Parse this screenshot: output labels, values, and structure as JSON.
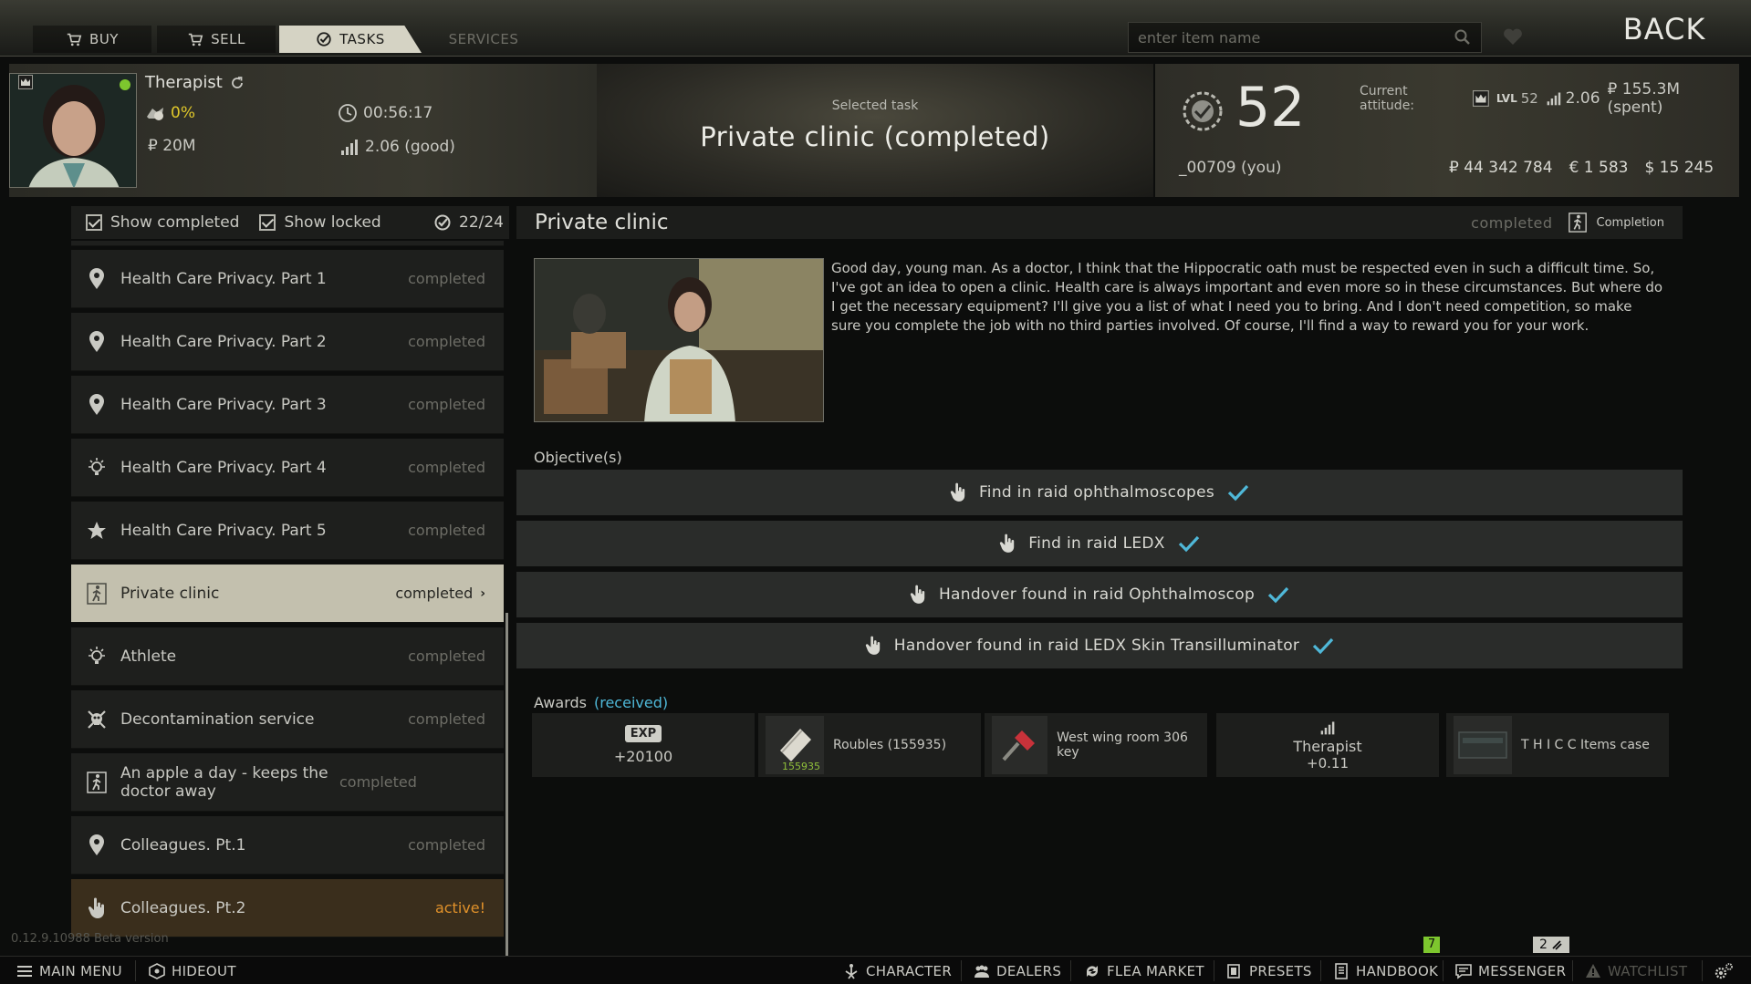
{
  "tabs": [
    {
      "label": "BUY",
      "icon": "cart-icon"
    },
    {
      "label": "SELL",
      "icon": "cart-icon"
    },
    {
      "label": "TASKS",
      "icon": "check-circle-icon"
    },
    {
      "label": "SERVICES",
      "icon": ""
    }
  ],
  "search": {
    "placeholder": "enter item name"
  },
  "back_label": "BACK",
  "trader": {
    "name": "Therapist",
    "percent": "0%",
    "timer": "00:56:17",
    "money": "₽ 20M",
    "standing": "2.06 (good)"
  },
  "selected_task": {
    "caption": "Selected task",
    "title": "Private clinic (completed)"
  },
  "player": {
    "level": "52",
    "name": "_00709 (you)",
    "attitude_label": "Current attitude:",
    "attitude_lvl_prefix": "LVL",
    "attitude_lvl": "52",
    "attitude_standing": "2.06",
    "attitude_spent": "₽ 155.3M (spent)",
    "roubles": "₽ 44 342 784",
    "euros": "€ 1 583",
    "dollars": "$ 15 245"
  },
  "filters": {
    "show_completed": "Show completed",
    "show_locked": "Show locked",
    "count": "22/24"
  },
  "tasks": [
    {
      "name": "Health Care Privacy. Part 1",
      "status": "completed",
      "icon": "pin"
    },
    {
      "name": "Health Care Privacy. Part 2",
      "status": "completed",
      "icon": "pin"
    },
    {
      "name": "Health Care Privacy. Part 3",
      "status": "completed",
      "icon": "pin"
    },
    {
      "name": "Health Care Privacy. Part 4",
      "status": "completed",
      "icon": "bulb"
    },
    {
      "name": "Health Care Privacy. Part 5",
      "status": "completed",
      "icon": "star"
    },
    {
      "name": "Private clinic",
      "status": "completed",
      "icon": "runner"
    },
    {
      "name": "Athlete",
      "status": "completed",
      "icon": "bulb"
    },
    {
      "name": "Decontamination service",
      "status": "completed",
      "icon": "skull"
    },
    {
      "name": "An apple a day - keeps the doctor away",
      "status": "completed",
      "icon": "runner"
    },
    {
      "name": "Colleagues. Pt.1",
      "status": "completed",
      "icon": "pin"
    },
    {
      "name": "Colleagues. Pt.2",
      "status": "active!",
      "icon": "hand"
    }
  ],
  "detail": {
    "title": "Private clinic",
    "status": "completed",
    "completion_label": "Completion",
    "description": "Good day, young man. As a doctor, I think that the Hippocratic oath must be respected even in such a difficult time. So, I've got an idea to open a clinic. Health care is always important and even more so in these circumstances. But where do I get the necessary equipment?  I'll give you a list of what I need you to bring. And I don't need competition, so make sure you complete the job with no third parties involved. Of course, I'll find a way to reward you for your work.",
    "objectives_label": "Objective(s)",
    "objectives": [
      "Find in raid ophthalmoscopes",
      "Find in raid LEDX",
      "Handover found in raid Ophthalmoscop",
      "Handover found in raid LEDX Skin Transilluminator"
    ],
    "awards_label": "Awards",
    "awards_state": "(received)"
  },
  "awards": {
    "exp_badge": "EXP",
    "exp_value": "+20100",
    "roubles_label": "Roubles (155935)",
    "roubles_count": "155935",
    "key_label": "West wing room 306 key",
    "rep_name": "Therapist",
    "rep_value": "+0.11",
    "case_label": "T H I C C Items case"
  },
  "version": "0.12.9.10988 Beta version",
  "bottom": {
    "main_menu": "MAIN MENU",
    "hideout": "HIDEOUT",
    "character": "CHARACTER",
    "dealers": "DEALERS",
    "flea": "FLEA MARKET",
    "presets": "PRESETS",
    "handbook": "HANDBOOK",
    "messenger": "MESSENGER",
    "watchlist": "WATCHLIST",
    "handbook_badge": "7",
    "messenger_badge": "2"
  },
  "colors": {
    "accent": "#e0912a",
    "check": "#4fb8d8",
    "selected": "#c3c0ae",
    "badge_green": "#7dc62e"
  }
}
